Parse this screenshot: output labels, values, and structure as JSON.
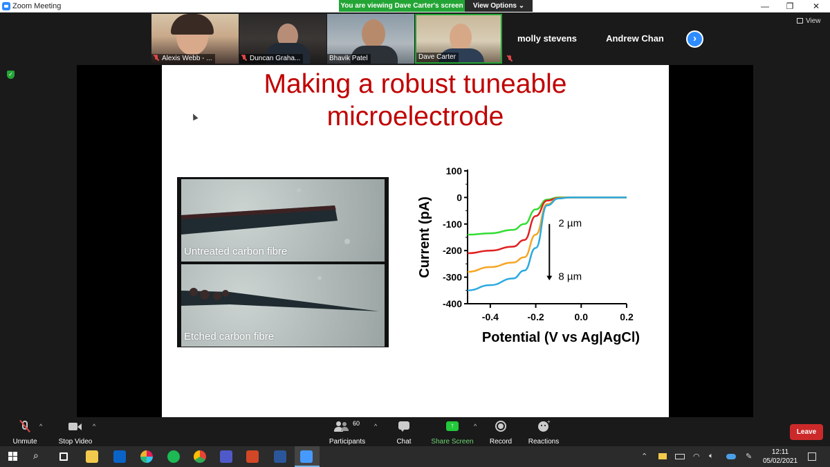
{
  "window": {
    "title": "Zoom Meeting",
    "viewing_banner": "You are viewing Dave Carter's screen",
    "view_options": "View Options ⌄",
    "view_label": "View"
  },
  "participants_strip": [
    {
      "name": "Alexis Webb - ...",
      "muted": true
    },
    {
      "name": "Duncan Graha...",
      "muted": true
    },
    {
      "name": "Bhavik Patel",
      "muted": false
    },
    {
      "name": "Dave Carter",
      "muted": false
    },
    {
      "name": "molly stevens"
    },
    {
      "name": "Andrew Chan"
    }
  ],
  "slide": {
    "title_line1": "Making a robust tuneable",
    "title_line2": "microelectrode",
    "image_captions": [
      "Untreated carbon fibre",
      "Etched carbon fibre"
    ]
  },
  "chart_data": {
    "type": "line",
    "xlabel": "Potential (V vs Ag|AgCl)",
    "ylabel": "Current (pA)",
    "xlim": [
      -0.5,
      0.2
    ],
    "ylim": [
      -400,
      100
    ],
    "xticks": [
      -0.4,
      -0.2,
      0.0,
      0.2
    ],
    "xtick_labels": [
      "-0.4",
      "-0.2",
      "0.0",
      "0.2"
    ],
    "yticks": [
      100,
      0,
      -100,
      -200,
      -300,
      -400
    ],
    "ytick_labels": [
      "100",
      "0",
      "-100",
      "-200",
      "-300",
      "-400"
    ],
    "annotations": [
      "2 µm",
      "8 µm"
    ],
    "series": [
      {
        "color": "#33dd33",
        "x": [
          -0.5,
          -0.4,
          -0.3,
          -0.25,
          -0.2,
          -0.15,
          -0.1,
          -0.05,
          0.0,
          0.2
        ],
        "y": [
          -140,
          -135,
          -122,
          -100,
          -45,
          -8,
          0,
          0,
          0,
          0
        ]
      },
      {
        "color": "#e02020",
        "x": [
          -0.5,
          -0.4,
          -0.3,
          -0.25,
          -0.2,
          -0.15,
          -0.1,
          -0.05,
          0.0,
          0.2
        ],
        "y": [
          -210,
          -200,
          -185,
          -160,
          -70,
          -12,
          -2,
          0,
          0,
          0
        ]
      },
      {
        "color": "#f5a623",
        "x": [
          -0.5,
          -0.4,
          -0.3,
          -0.25,
          -0.2,
          -0.15,
          -0.1,
          -0.05,
          0.0,
          0.2
        ],
        "y": [
          -280,
          -262,
          -245,
          -225,
          -140,
          -25,
          -3,
          0,
          0,
          0
        ]
      },
      {
        "color": "#2aa9e0",
        "x": [
          -0.5,
          -0.4,
          -0.3,
          -0.25,
          -0.2,
          -0.15,
          -0.1,
          -0.05,
          0.0,
          0.2
        ],
        "y": [
          -350,
          -330,
          -305,
          -275,
          -190,
          -30,
          -4,
          0,
          0,
          0
        ]
      }
    ]
  },
  "toolbar": {
    "unmute": "Unmute",
    "stop_video": "Stop Video",
    "participants": "Participants",
    "participants_count": "60",
    "chat": "Chat",
    "share_screen": "Share Screen",
    "record": "Record",
    "reactions": "Reactions",
    "leave": "Leave"
  },
  "taskbar": {
    "time": "12:11",
    "date": "05/02/2021"
  }
}
